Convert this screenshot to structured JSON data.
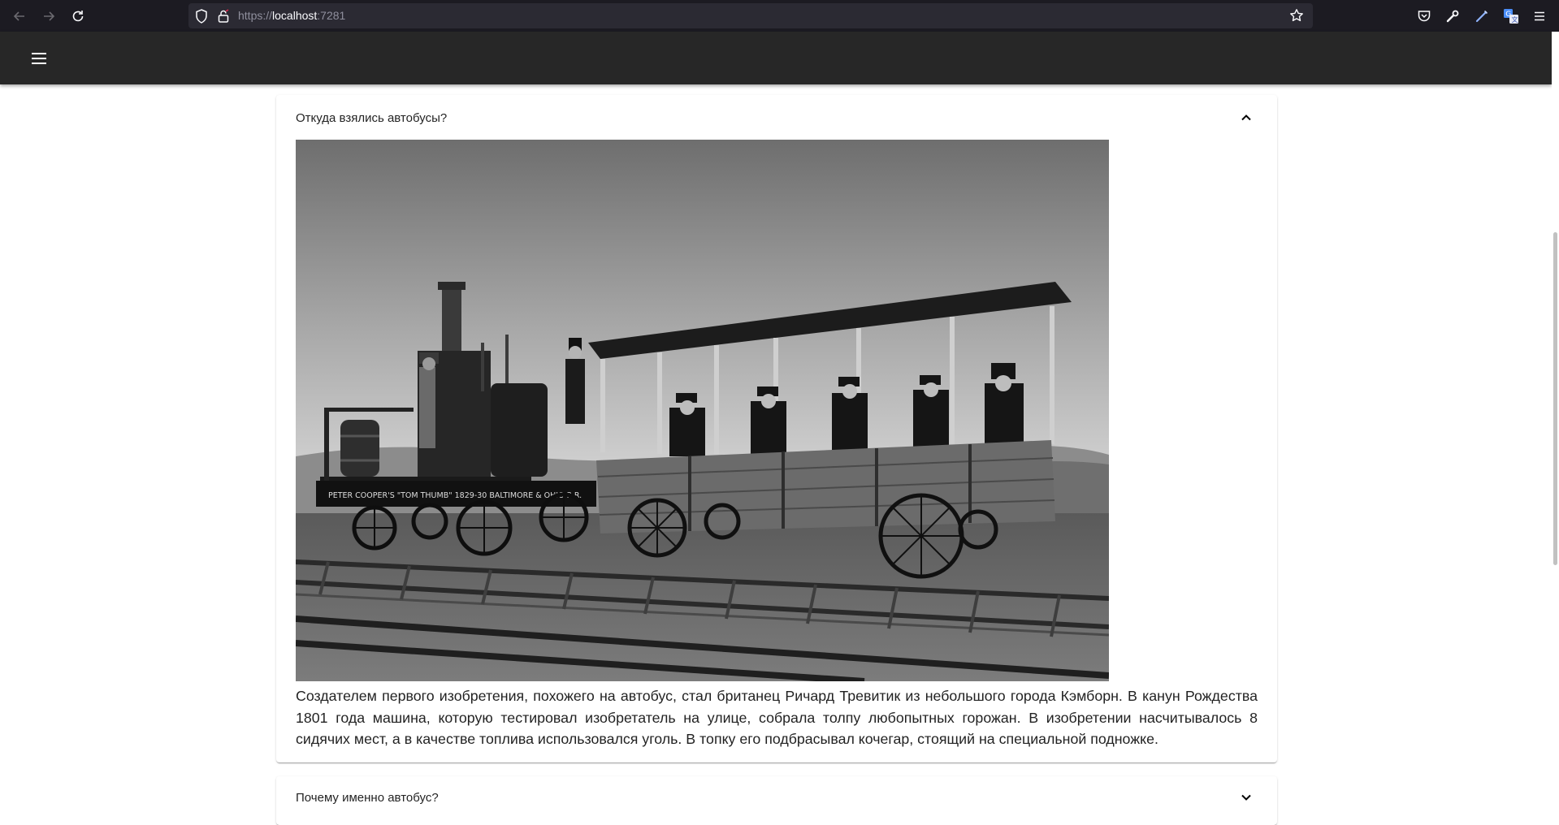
{
  "browser": {
    "url_scheme": "https://",
    "url_host": "localhost",
    "url_port": ":7281",
    "icons": [
      "back-icon",
      "forward-icon",
      "reload-icon",
      "shield-icon",
      "lock-icon",
      "star-icon",
      "pocket-icon",
      "wrench-icon",
      "pen-icon",
      "translate-icon",
      "menu-icon"
    ]
  },
  "accordion": [
    {
      "title": "Откуда взялись автобусы?",
      "expanded": true,
      "image_text": "PETER COOPER'S \"TOM THUMB\" 1829-30 BALTIMORE & OHIO R.R.",
      "body": "Создателем первого изобретения, похожего на автобус, стал британец Ричард Тревитик из небольшого города Кэмборн. В канун Рождества 1801 года машина, которую тестировал изобретатель на улице, собрала толпу любопытных горожан. В изобретении насчитывалось 8 сидячих мест, а в качестве топлива использовался уголь. В топку его подбрасывал кочегар, стоящий на специальной подножке."
    },
    {
      "title": "Почему именно автобус?",
      "expanded": false
    }
  ],
  "colors": {
    "browser_bg": "#1c1b22",
    "url_bar_bg": "#2b2a33",
    "app_bar_bg": "#272727",
    "page_bg": "#ffffff"
  }
}
